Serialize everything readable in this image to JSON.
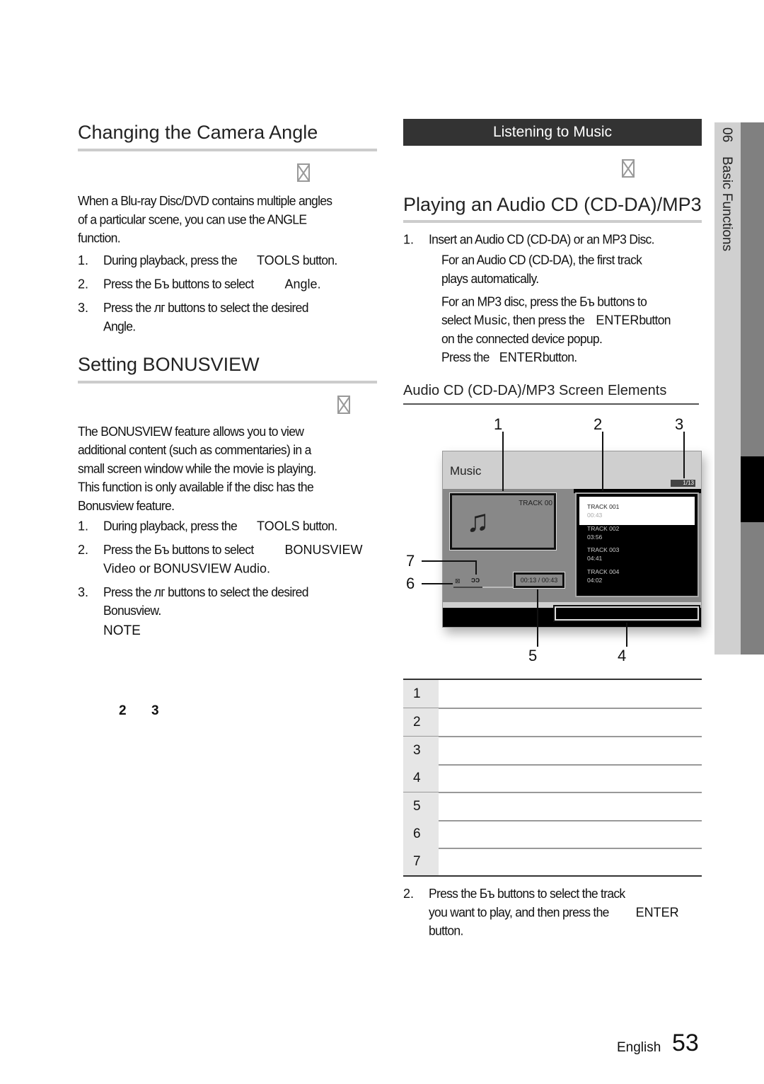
{
  "left": {
    "camera_angle": {
      "title": "Changing the Camera Angle",
      "intro": [
        "When a Blu-ray Disc/DVD contains multiple angles",
        "of a particular scene, you can use the ANGLE",
        "function."
      ],
      "steps": [
        {
          "n": "1.",
          "text": "During playback, press the",
          "ui": "TOOLS",
          "after": "button."
        },
        {
          "n": "2.",
          "text": "Press the Бъ buttons to select",
          "ui": "Angle",
          "after": "."
        },
        {
          "n": "3.",
          "text": "Press the лг buttons to select the desired",
          "line2": "Angle."
        }
      ]
    },
    "bonusview": {
      "title": "Setting BONUSVIEW",
      "intro": [
        "The BONUSVIEW feature allows you to view",
        "additional content (such as commentaries) in a",
        "small screen window while the movie is playing.",
        "This function is only available if the disc has the",
        "Bonusview feature."
      ],
      "steps": [
        {
          "n": "1.",
          "text": "During playback, press the",
          "ui": "TOOLS",
          "after": "button."
        },
        {
          "n": "2.",
          "text": "Press the Бъ buttons to select",
          "ui": "BONUSVIEW",
          "line2a": "Video or",
          "line2b": "BONUSVIEW Audio."
        },
        {
          "n": "3.",
          "text": "Press the лг buttons to select the desired",
          "line2": "Bonusview."
        }
      ],
      "note_label": "NOTE",
      "note_nums": [
        "2",
        "3"
      ]
    }
  },
  "right": {
    "banner": "Listening to Music",
    "title": "Playing an Audio CD (CD-DA)/MP3",
    "step1": {
      "n": "1.",
      "text": "Insert an Audio CD (CD-DA) or an MP3 Disc."
    },
    "para1": [
      "For an Audio CD (CD-DA), the first track",
      "plays automatically."
    ],
    "para2": {
      "l1": "For an MP3 disc, press the Бъ buttons to",
      "l2a": "select",
      "l2ui": "Music",
      "l2b": ", then press the",
      "l2ui2": "ENTER",
      "l2c": "button",
      "l3": "on the connected device popup.",
      "l4a": "Press the",
      "l4ui": "ENTER",
      "l4b": "button."
    },
    "subtitle": "Audio CD (CD-DA)/MP3 Screen Elements",
    "screen": {
      "title": "Music",
      "counter": "1/13",
      "now_track": "TRACK 00",
      "time": "00:13 / 00:43",
      "tracks": [
        {
          "name": "TRACK 001",
          "time": "00:43"
        },
        {
          "name": "TRACK 002",
          "time": "03:56"
        },
        {
          "name": "TRACK 003",
          "time": "04:41"
        },
        {
          "name": "TRACK 004",
          "time": "04:02"
        }
      ],
      "callouts": [
        "1",
        "2",
        "3",
        "4",
        "5",
        "6",
        "7"
      ]
    },
    "table_nums": [
      "1",
      "2",
      "3",
      "4",
      "5",
      "6",
      "7"
    ],
    "step2": {
      "n": "2.",
      "l1": "Press the Бъ buttons to select the track",
      "l2": "you want to play, and then press the",
      "ui": "ENTER",
      "l3": "button."
    }
  },
  "side_tab": {
    "chapter": "06",
    "label": "Basic Functions"
  },
  "footer": {
    "language": "English",
    "page": "53"
  }
}
